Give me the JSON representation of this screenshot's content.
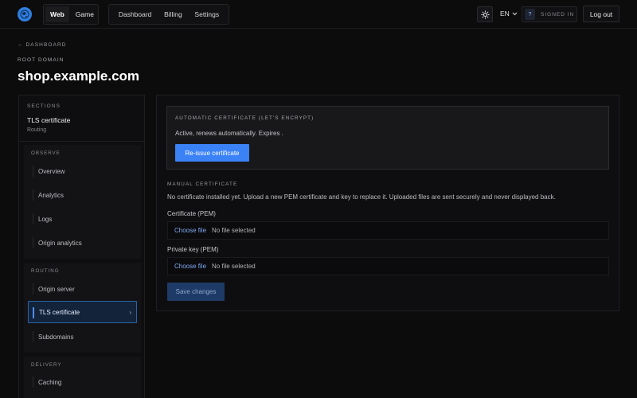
{
  "header": {
    "mode_tabs": [
      "Web",
      "Game"
    ],
    "nav": [
      "Dashboard",
      "Billing",
      "Settings"
    ],
    "language": "EN",
    "signed_badge": "?",
    "signed_label": "SIGNED IN",
    "logout": "Log out"
  },
  "page": {
    "back_label": "← DASHBOARD",
    "eyebrow": "ROOT DOMAIN",
    "title": "shop.example.com"
  },
  "sidebar": {
    "sections_label": "SECTIONS",
    "current": "TLS certificate",
    "current_sub": "Routing",
    "groups": [
      {
        "label": "OBSERVE",
        "items": [
          "Overview",
          "Analytics",
          "Logs",
          "Origin analytics"
        ]
      },
      {
        "label": "ROUTING",
        "items": [
          "Origin server",
          "TLS certificate",
          "Subdomains"
        ]
      },
      {
        "label": "DELIVERY",
        "items": [
          "Caching"
        ]
      }
    ]
  },
  "auto_cert": {
    "title": "AUTOMATIC CERTIFICATE (LET'S ENCRYPT)",
    "status": "Active, renews automatically. Expires .",
    "reissue": "Re-issue certificate"
  },
  "manual_cert": {
    "title": "MANUAL CERTIFICATE",
    "description": "No certificate installed yet. Upload a new PEM certificate and key to replace it. Uploaded files are sent securely and never displayed back.",
    "cert_label": "Certificate (PEM)",
    "key_label": "Private key (PEM)",
    "choose_file": "Choose file",
    "no_file": "No file selected",
    "save": "Save changes"
  },
  "colors": {
    "accent": "#3b82f6",
    "background": "#0c0c0d",
    "active_item_border": "#2c62a8"
  },
  "icons": {
    "logo": "globe-logo-icon",
    "theme": "sun-icon",
    "language": "chevron-down-icon",
    "active_item": "chevron-right-icon"
  }
}
